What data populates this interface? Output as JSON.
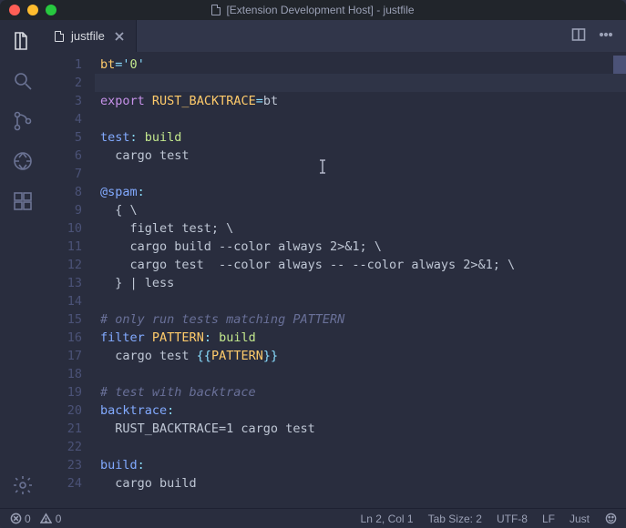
{
  "window": {
    "title": "[Extension Development Host] - justfile"
  },
  "tabs": [
    {
      "label": "justfile"
    }
  ],
  "activity_icons": [
    "files",
    "search",
    "git",
    "debug",
    "extensions",
    "settings"
  ],
  "statusbar": {
    "errors": "0",
    "warnings": "0",
    "line_col": "Ln 2, Col 1",
    "tab_size": "Tab Size: 2",
    "encoding": "UTF-8",
    "eol": "LF",
    "language": "Just"
  },
  "gutter": [
    "1",
    "2",
    "3",
    "4",
    "5",
    "6",
    "7",
    "8",
    "9",
    "10",
    "11",
    "12",
    "13",
    "14",
    "15",
    "16",
    "17",
    "18",
    "19",
    "20",
    "21",
    "22",
    "23",
    "24"
  ],
  "code_lines": [
    {
      "n": 1,
      "seg": [
        [
          "ident",
          "bt"
        ],
        [
          "punc",
          "="
        ],
        [
          "strq",
          "'"
        ],
        [
          "str",
          "0"
        ],
        [
          "strq",
          "'"
        ]
      ]
    },
    {
      "n": 2,
      "seg": [],
      "sel": true
    },
    {
      "n": 3,
      "seg": [
        [
          "key",
          "export"
        ],
        [
          "plain",
          " "
        ],
        [
          "ident",
          "RUST_BACKTRACE"
        ],
        [
          "punc",
          "="
        ],
        [
          "plain",
          "bt"
        ]
      ]
    },
    {
      "n": 4,
      "seg": []
    },
    {
      "n": 5,
      "seg": [
        [
          "target",
          "test"
        ],
        [
          "punc",
          ":"
        ],
        [
          "plain",
          " "
        ],
        [
          "dep",
          "build"
        ]
      ]
    },
    {
      "n": 6,
      "seg": [
        [
          "plain",
          "  cargo test"
        ]
      ]
    },
    {
      "n": 7,
      "seg": []
    },
    {
      "n": 8,
      "seg": [
        [
          "target",
          "@spam"
        ],
        [
          "punc",
          ":"
        ]
      ]
    },
    {
      "n": 9,
      "seg": [
        [
          "plain",
          "  { \\"
        ]
      ]
    },
    {
      "n": 10,
      "seg": [
        [
          "plain",
          "    figlet test; \\"
        ]
      ]
    },
    {
      "n": 11,
      "seg": [
        [
          "plain",
          "    cargo build --color always 2>&1; \\"
        ]
      ]
    },
    {
      "n": 12,
      "seg": [
        [
          "plain",
          "    cargo test  --color always -- --color always 2>&1; \\"
        ]
      ]
    },
    {
      "n": 13,
      "seg": [
        [
          "plain",
          "  } | less"
        ]
      ]
    },
    {
      "n": 14,
      "seg": []
    },
    {
      "n": 15,
      "seg": [
        [
          "cmt",
          "# only run tests matching PATTERN"
        ]
      ]
    },
    {
      "n": 16,
      "seg": [
        [
          "target",
          "filter"
        ],
        [
          "plain",
          " "
        ],
        [
          "ident",
          "PATTERN"
        ],
        [
          "punc",
          ":"
        ],
        [
          "plain",
          " "
        ],
        [
          "dep",
          "build"
        ]
      ]
    },
    {
      "n": 17,
      "seg": [
        [
          "plain",
          "  cargo test "
        ],
        [
          "var",
          "{{"
        ],
        [
          "ident",
          "PATTERN"
        ],
        [
          "var",
          "}}"
        ]
      ]
    },
    {
      "n": 18,
      "seg": []
    },
    {
      "n": 19,
      "seg": [
        [
          "cmt",
          "# test with backtrace"
        ]
      ]
    },
    {
      "n": 20,
      "seg": [
        [
          "target",
          "backtrace"
        ],
        [
          "punc",
          ":"
        ]
      ]
    },
    {
      "n": 21,
      "seg": [
        [
          "plain",
          "  RUST_BACKTRACE=1 cargo test"
        ]
      ]
    },
    {
      "n": 22,
      "seg": []
    },
    {
      "n": 23,
      "seg": [
        [
          "target",
          "build"
        ],
        [
          "punc",
          ":"
        ]
      ]
    },
    {
      "n": 24,
      "seg": [
        [
          "plain",
          "  cargo build"
        ]
      ]
    }
  ]
}
